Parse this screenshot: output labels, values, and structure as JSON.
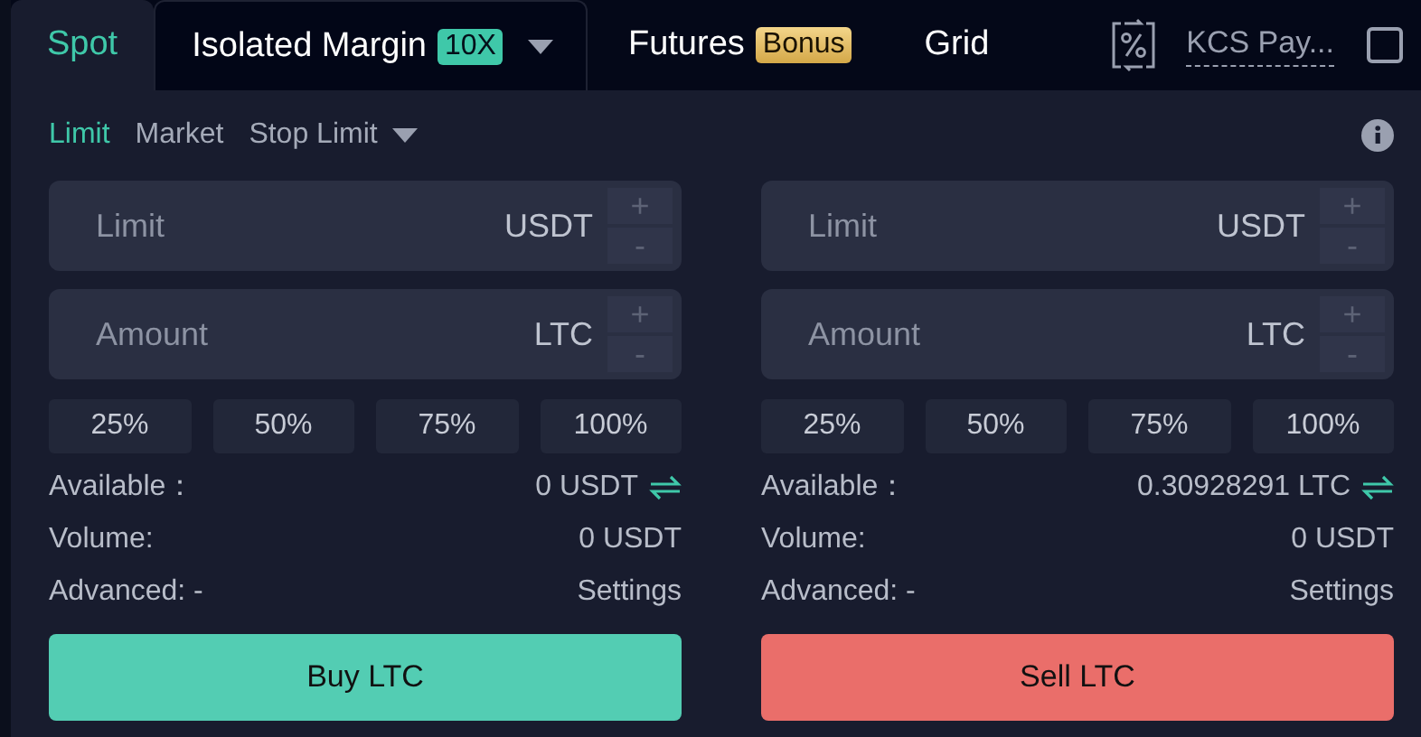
{
  "tabs": [
    {
      "label": "Spot",
      "selected": true,
      "kind": "plain"
    },
    {
      "label": "Isolated Margin",
      "selected": false,
      "kind": "dropdown",
      "badge": {
        "text": "10X",
        "kind": "leverage"
      }
    },
    {
      "label": "Futures",
      "selected": false,
      "kind": "plain",
      "badge": {
        "text": "Bonus",
        "kind": "promo"
      }
    },
    {
      "label": "Grid",
      "selected": false,
      "kind": "plain"
    }
  ],
  "fee_toggle": {
    "label": "KCS Pay...",
    "checked": false
  },
  "order_types": [
    {
      "label": "Limit",
      "selected": true,
      "kind": "plain"
    },
    {
      "label": "Market",
      "selected": false,
      "kind": "plain"
    },
    {
      "label": "Stop Limit",
      "selected": false,
      "kind": "dropdown"
    }
  ],
  "panels": [
    {
      "fields": [
        {
          "placeholder": "Limit",
          "unit": "USDT",
          "steps": [
            "+",
            "-"
          ]
        },
        {
          "placeholder": "Amount",
          "unit": "LTC",
          "steps": [
            "+",
            "-"
          ]
        }
      ],
      "percents": [
        "25%",
        "50%",
        "75%",
        "100%"
      ],
      "available": {
        "label": "Available：",
        "value": "0 USDT"
      },
      "volume": {
        "label": "Volume:",
        "value": "0 USDT"
      },
      "advanced": {
        "label": "Advanced: -",
        "link": "Settings"
      },
      "submit": {
        "label": "Buy LTC",
        "kind": "buy"
      }
    },
    {
      "fields": [
        {
          "placeholder": "Limit",
          "unit": "USDT",
          "steps": [
            "+",
            "-"
          ]
        },
        {
          "placeholder": "Amount",
          "unit": "LTC",
          "steps": [
            "+",
            "-"
          ]
        }
      ],
      "percents": [
        "25%",
        "50%",
        "75%",
        "100%"
      ],
      "available": {
        "label": "Available：",
        "value": "0.30928291 LTC"
      },
      "volume": {
        "label": "Volume:",
        "value": "0 USDT"
      },
      "advanced": {
        "label": "Advanced: -",
        "link": "Settings"
      },
      "submit": {
        "label": "Sell LTC",
        "kind": "sell"
      }
    }
  ]
}
